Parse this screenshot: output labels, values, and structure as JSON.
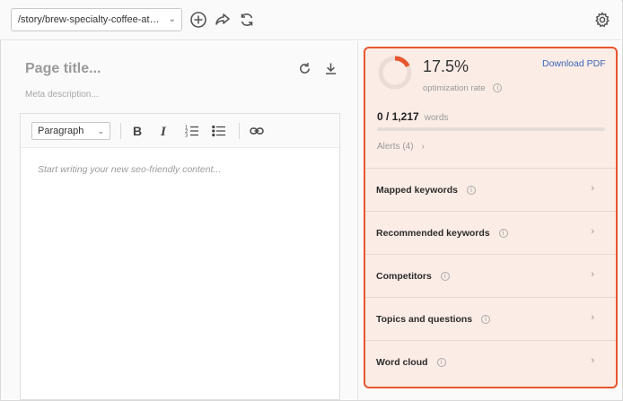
{
  "toolbar": {
    "url": "/story/brew-specialty-coffee-at-ho...",
    "icons": [
      "plus-circle-icon",
      "share-icon",
      "refresh-icon",
      "gear-icon"
    ]
  },
  "editor": {
    "title_placeholder": "Page title...",
    "meta_placeholder": "Meta description...",
    "format_select": "Paragraph",
    "content_placeholder": "Start writing your new seo-friendly content..."
  },
  "panel": {
    "rate": "17.5%",
    "rate_value": 0.175,
    "rate_label": "optimization rate",
    "download": "Download PDF",
    "words_count": "0 / 1,217",
    "words_unit": "words",
    "words_progress": 0,
    "alerts": "Alerts (4)",
    "sections": [
      {
        "label": "Mapped keywords"
      },
      {
        "label": "Recommended keywords"
      },
      {
        "label": "Competitors"
      },
      {
        "label": "Topics and questions"
      },
      {
        "label": "Word cloud"
      }
    ]
  },
  "colors": {
    "accent": "#e8562f",
    "highlight_bg": "#fbe0d6",
    "link": "#3a67b8"
  }
}
